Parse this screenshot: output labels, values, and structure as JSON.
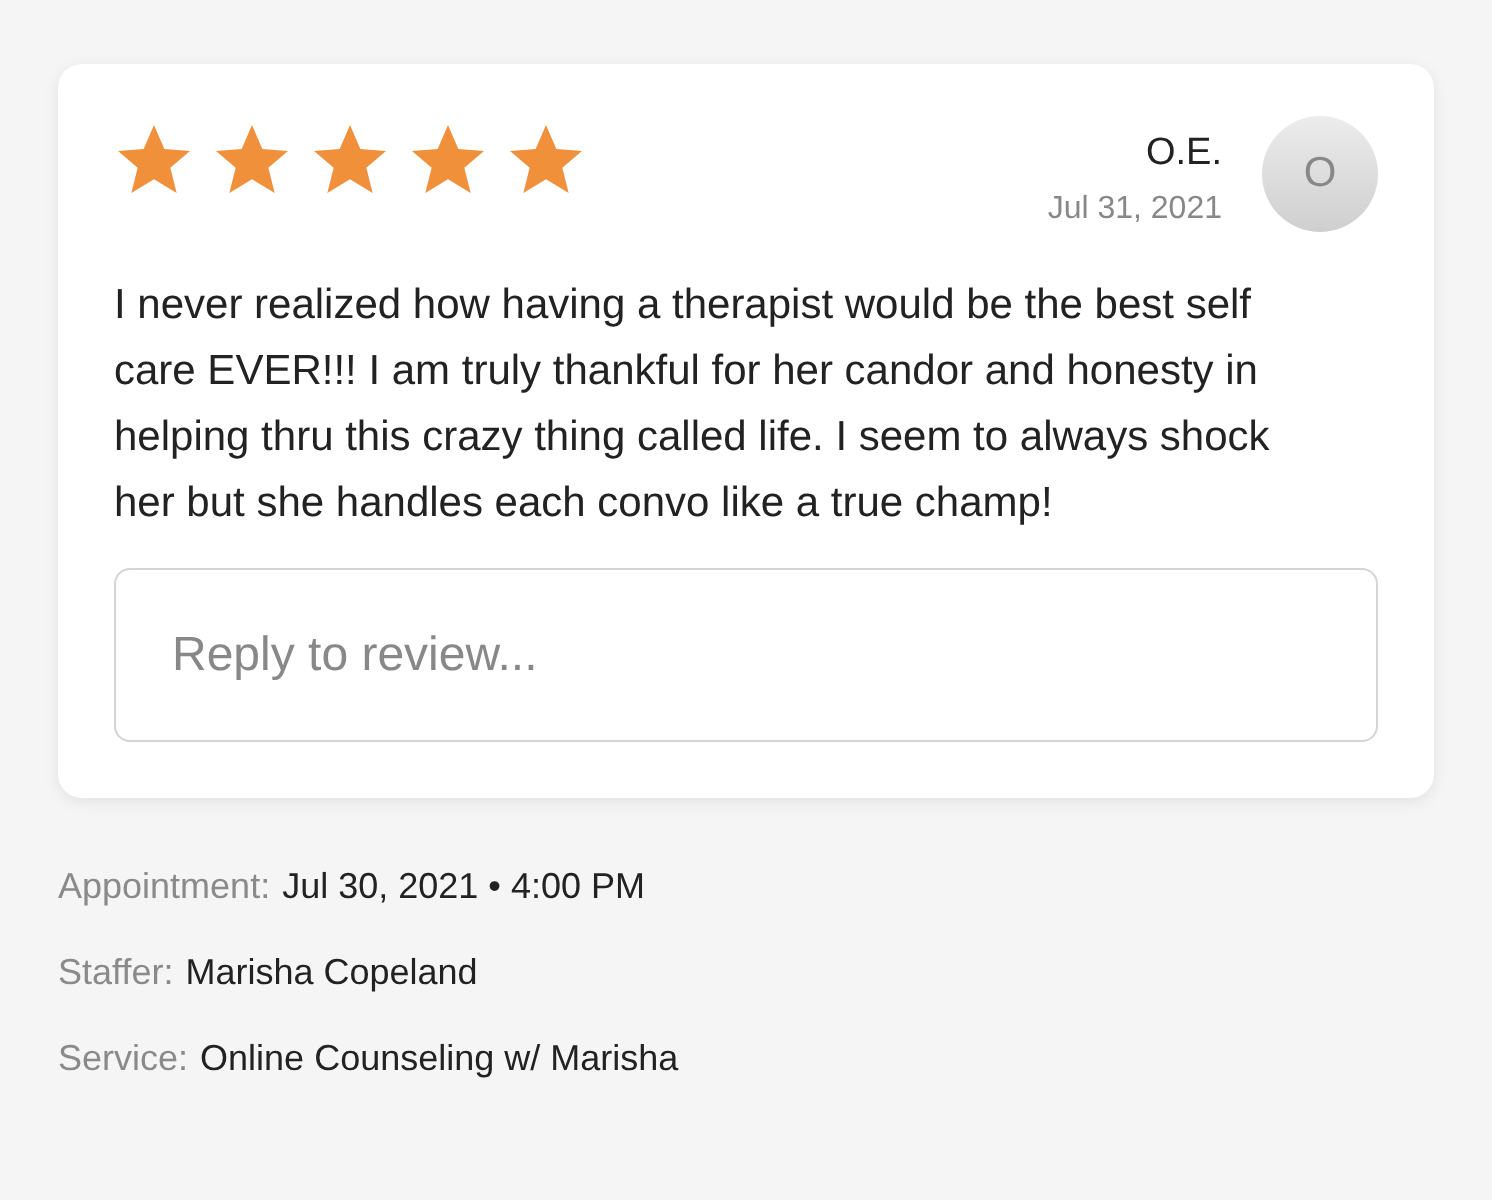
{
  "review": {
    "stars": 5,
    "author": "O.E.",
    "avatar_initial": "O",
    "date": "Jul 31, 2021",
    "text": "I never realized how having a therapist would be the best self care EVER!!! I am truly thankful for her candor and honesty in helping thru this crazy thing called life. I seem to always shock her but she handles each convo like a true champ!",
    "reply": {
      "placeholder": "Reply to review..."
    }
  },
  "details": [
    {
      "label": "Appointment:",
      "value": "Jul 30, 2021 • 4:00 PM"
    },
    {
      "label": "Staffer:",
      "value": "Marisha Copeland"
    },
    {
      "label": "Service:",
      "value": "Online Counseling w/ Marisha"
    }
  ]
}
